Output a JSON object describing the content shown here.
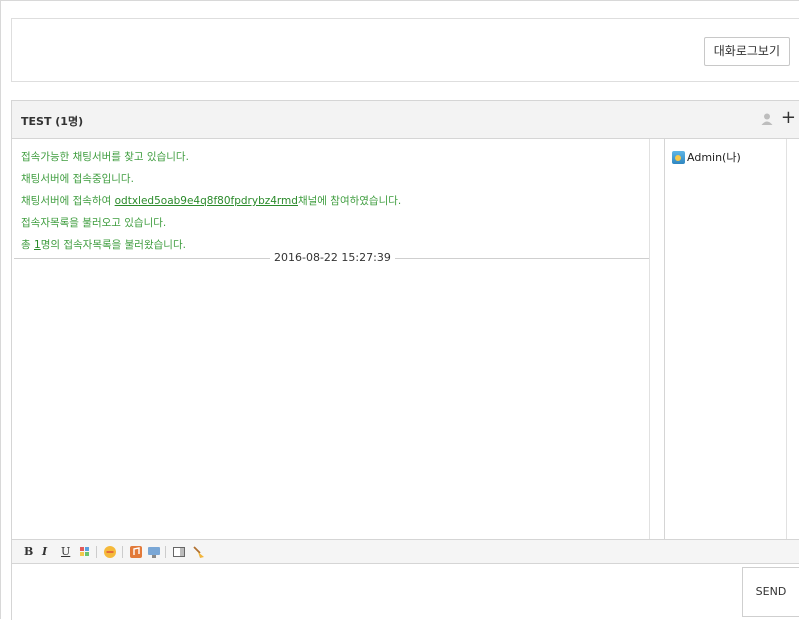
{
  "top_button": "대화로그보기",
  "room": {
    "title": "TEST (1명)"
  },
  "messages": {
    "m1": "접속가능한 채팅서버를 찾고 있습니다.",
    "m2": "채팅서버에 접속중입니다.",
    "m3_prefix": "채팅서버에 접속하여 ",
    "m3_link": "odtxled5oab9e4q8f80fpdrybz4rmd",
    "m3_suffix": "채널에 참여하였습니다.",
    "m4": "접속자목록을 불러오고 있습니다.",
    "m5_prefix": "총 ",
    "m5_count": "1",
    "m5_suffix": "명의 접속자목록을 불러왔습니다."
  },
  "date_separator": "2016-08-22 15:27:39",
  "users": [
    {
      "name": "Admin(나)"
    }
  ],
  "toolbar": {
    "bold": "B",
    "italic": "I",
    "underline": "U"
  },
  "send_label": "SEND",
  "icons": [
    "user-icon",
    "plus-icon",
    "color-icon",
    "emoticon-icon",
    "music-icon",
    "monitor-icon",
    "box-icon",
    "broom-icon"
  ],
  "colors": {
    "message_text": "#3f9d3f",
    "link": "#2a8a2a"
  }
}
